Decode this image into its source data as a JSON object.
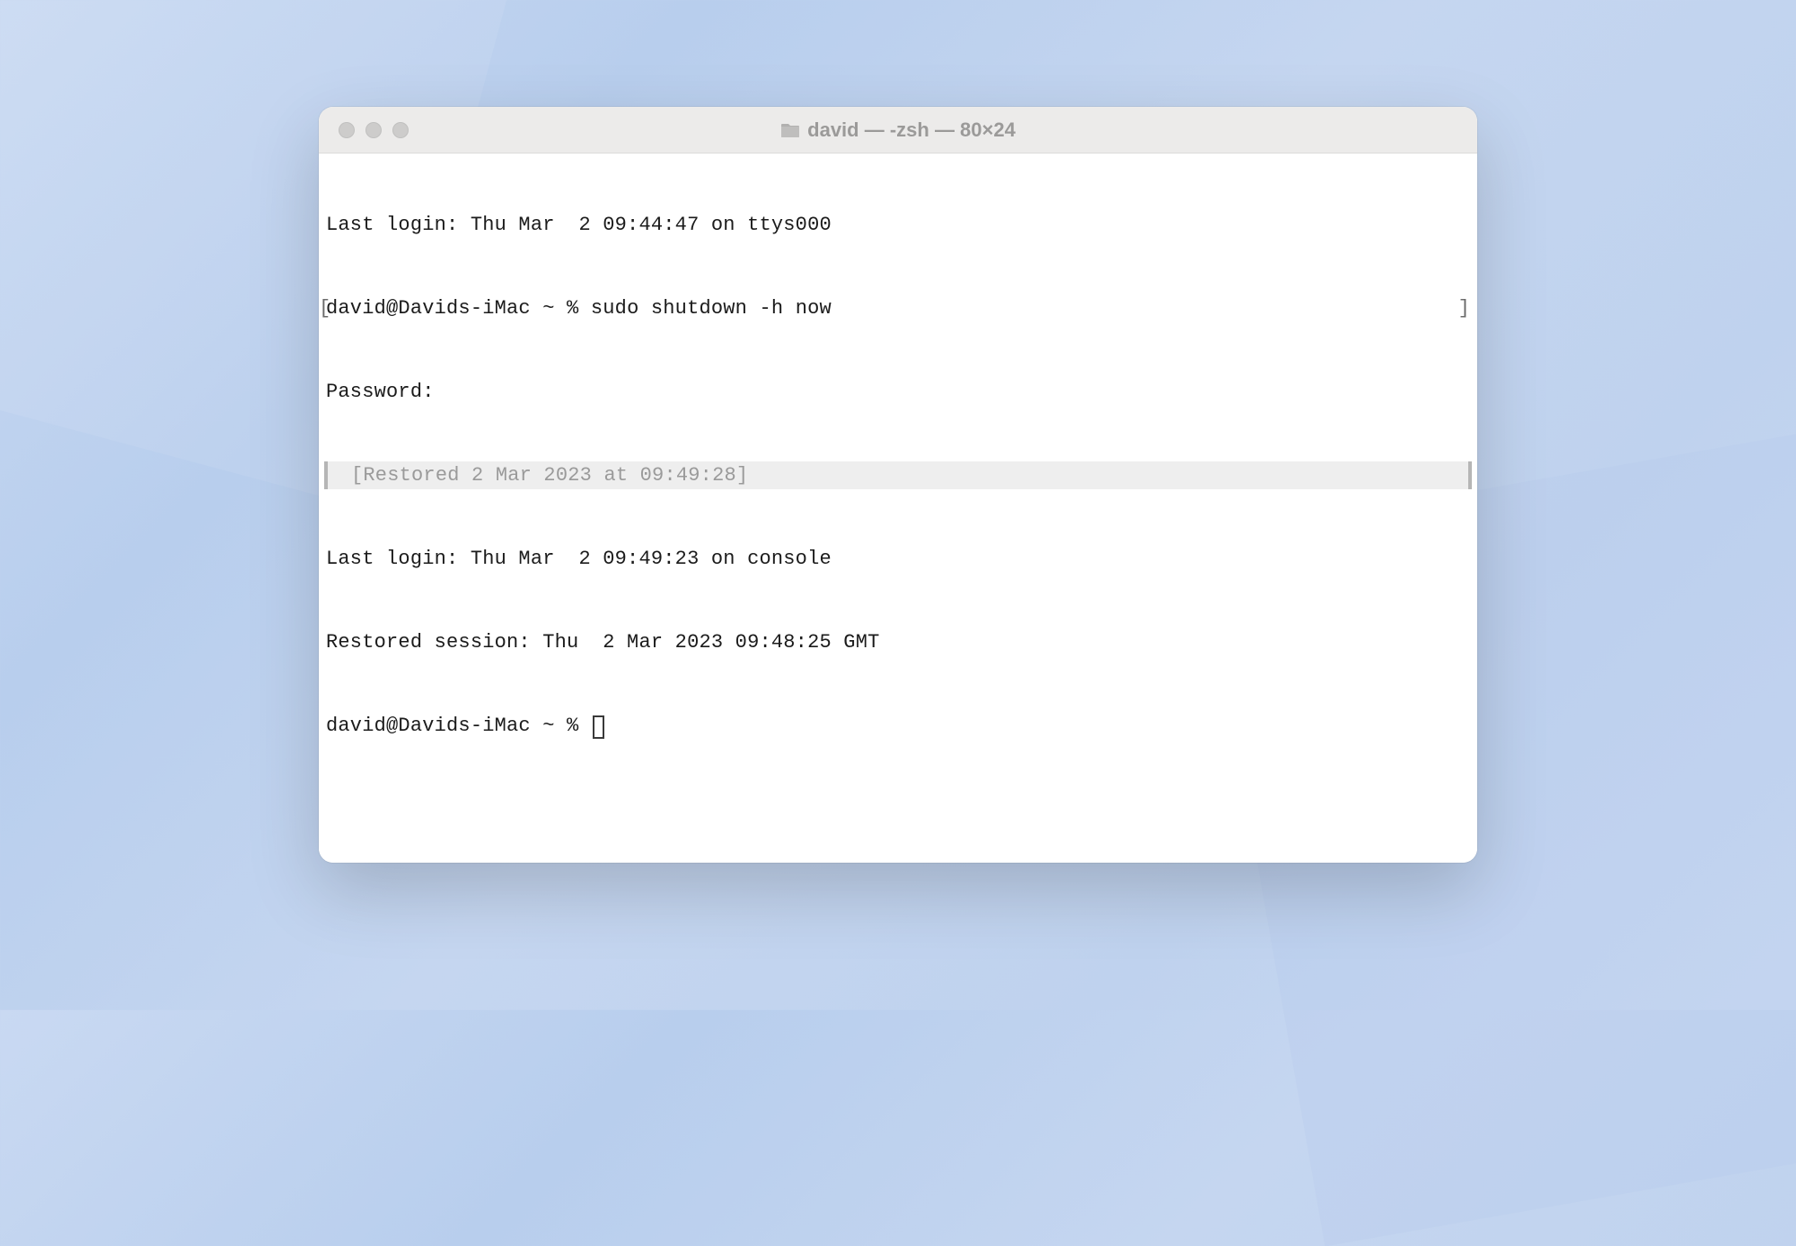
{
  "window": {
    "title": "david — -zsh — 80×24"
  },
  "terminal": {
    "lines": {
      "l0": "Last login: Thu Mar  2 09:44:47 on ttys000",
      "l1_prompt": "david@Davids-iMac ~ % ",
      "l1_cmd": "sudo shutdown -h now",
      "l2": "Password:",
      "l3_restored": "[Restored 2 Mar 2023 at 09:49:28]",
      "l4": "Last login: Thu Mar  2 09:49:23 on console",
      "l5": "Restored session: Thu  2 Mar 2023 09:48:25 GMT",
      "l6_prompt": "david@Davids-iMac ~ % "
    }
  }
}
